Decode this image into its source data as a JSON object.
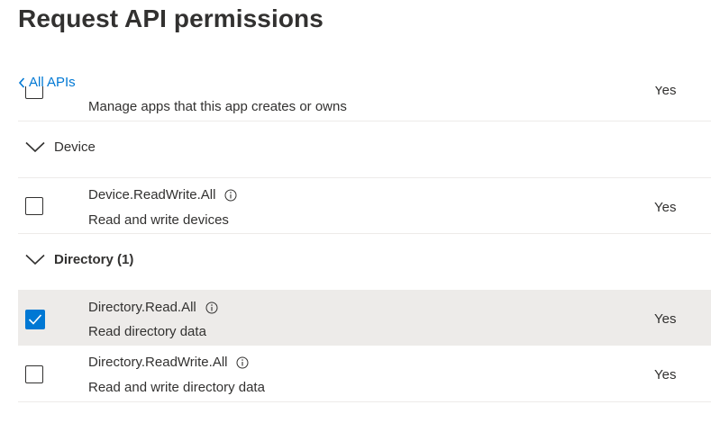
{
  "page": {
    "title": "Request API permissions",
    "back_label": "All APIs"
  },
  "partial_row": {
    "description": "Manage apps that this app creates or owns",
    "admin_consent": "Yes"
  },
  "groups": [
    {
      "name": "Device",
      "count": "",
      "permissions": [
        {
          "name": "Device.ReadWrite.All",
          "description": "Read and write devices",
          "admin_consent": "Yes",
          "checked": false
        }
      ]
    },
    {
      "name": "Directory (1)",
      "permissions": [
        {
          "name": "Directory.Read.All",
          "description": "Read directory data",
          "admin_consent": "Yes",
          "checked": true
        },
        {
          "name": "Directory.ReadWrite.All",
          "description": "Read and write directory data",
          "admin_consent": "Yes",
          "checked": false
        }
      ]
    }
  ],
  "colors": {
    "accent": "#0078d4",
    "text": "#323130",
    "selected_row": "#edebe9",
    "divider": "#edebe9"
  }
}
